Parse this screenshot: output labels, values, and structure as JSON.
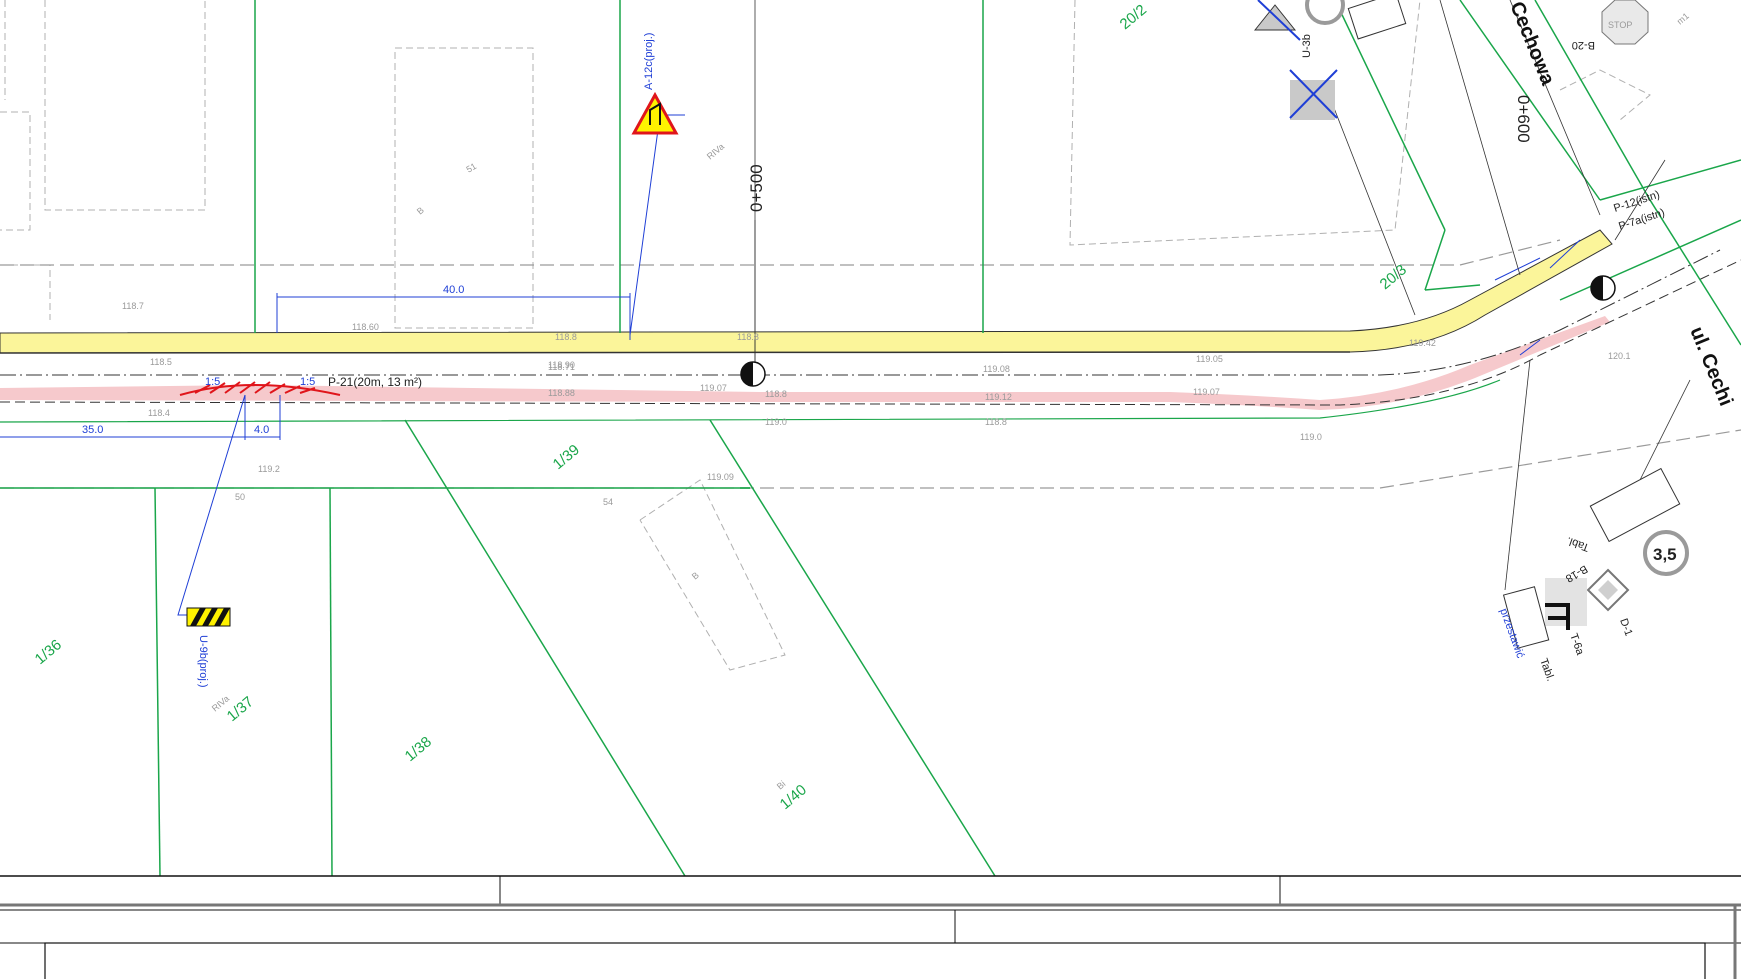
{
  "streets": {
    "street_top": "Cechowa",
    "street_right": "ul. Cechi"
  },
  "chainage": {
    "km_500": "0+500",
    "km_600": "0+600"
  },
  "parcels": {
    "p51": "51",
    "p50": "50",
    "p54": "54",
    "p1_36": "1/36",
    "p1_37": "1/37",
    "p1_38": "1/38",
    "p1_39": "1/39",
    "p1_40": "1/40",
    "p20_2": "20/2",
    "p20_3": "20/3"
  },
  "land_use": {
    "rivo_1": "RIVa",
    "rivo_2": "RIVa",
    "bi": "Bi",
    "b": "B",
    "ba": "B"
  },
  "dimensions": {
    "d40": "40.0",
    "d35": "35.0",
    "d4": "4.0",
    "slope_left": "1:5",
    "slope_right": "1:5"
  },
  "labels": {
    "marking": "P-21(20m, 13 m²)",
    "sign_a12c": "A-12c(proj.)",
    "sign_u9b": "U-9b(proj.)",
    "sign_p12": "P-12(istn)",
    "sign_p7a": "P-7a(istn)",
    "sign_u3b": "U-3b",
    "sign_b20": "B-20",
    "sign_b18": "B-18",
    "sign_d1": "D-1",
    "sign_t6a": "T-6a",
    "tabl_1": "Tabl.",
    "tabl_2": "Tabl.",
    "przestawic": "przestawić",
    "stop": "STOP",
    "weight": "3,5",
    "ml": "m1"
  },
  "elevations": [
    "118.8",
    "118.90",
    "118.88",
    "118.71",
    "118.60",
    "118.5",
    "118.4",
    "118.8",
    "118.8",
    "119.07",
    "119.09",
    "119.0",
    "119.08",
    "119.05",
    "119.12",
    "119.07",
    "118.8",
    "119.42",
    "119.0",
    "118.7",
    "119.2",
    "120.1"
  ],
  "colors": {
    "parcel_line": "#1aa64a",
    "dimension_line": "#1f3fd6",
    "sidewalk": "#fbf59a",
    "bike_lane": "#f6c9cc",
    "hatch": "#e0151b"
  }
}
